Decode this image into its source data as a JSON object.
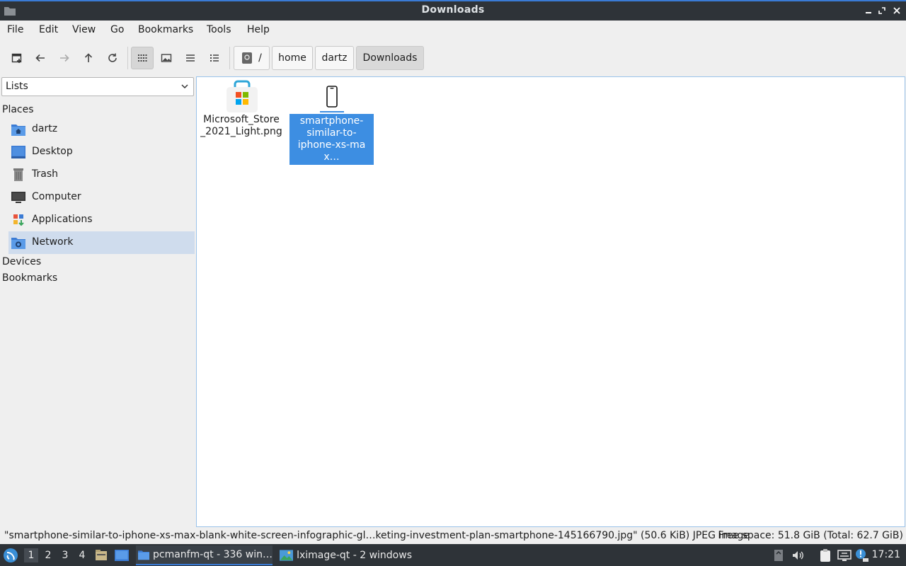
{
  "window": {
    "title": "Downloads"
  },
  "menu": [
    "File",
    "Edit",
    "View",
    "Go",
    "Bookmarks",
    "Tools",
    "Help"
  ],
  "breadcrumb": {
    "root": "/",
    "parts": [
      "home",
      "dartz",
      "Downloads"
    ]
  },
  "sidebar": {
    "combo_value": "Lists",
    "places_header": "Places",
    "places": [
      {
        "label": "dartz",
        "icon": "home-folder-icon"
      },
      {
        "label": "Desktop",
        "icon": "desktop-icon"
      },
      {
        "label": "Trash",
        "icon": "trash-icon"
      },
      {
        "label": "Computer",
        "icon": "computer-icon"
      },
      {
        "label": "Applications",
        "icon": "applications-icon"
      },
      {
        "label": "Network",
        "icon": "network-icon",
        "selected": true
      }
    ],
    "devices_header": "Devices",
    "bookmarks_header": "Bookmarks"
  },
  "files": [
    {
      "name": "Microsoft_Store_2021_Light.png",
      "line1": "Microsoft_Store",
      "line2": "_2021_Light.png",
      "icon": "microsoft-store-icon"
    },
    {
      "name": "smartphone-similar-to-iphone-xs-max…",
      "line1": "smartphone-",
      "line2": "similar-to-",
      "line3": "iphone-xs-max…",
      "icon": "smartphone-image-icon",
      "selected": true
    }
  ],
  "status": {
    "left": "\"smartphone-similar-to-iphone-xs-max-blank-white-screen-infographic-gl…keting-investment-plan-smartphone-145166790.jpg\" (50.6 KiB) JPEG image",
    "right": "Free space: 51.8 GiB (Total: 62.7 GiB)"
  },
  "taskbar": {
    "workspaces": [
      "1",
      "2",
      "3",
      "4"
    ],
    "tasks": [
      {
        "label": "pcmanfm-qt - 336 win…",
        "active": true
      },
      {
        "label": "lximage-qt - 2 windows",
        "active": false
      }
    ],
    "clock": "17:21"
  },
  "colors": {
    "accent": "#3d8ee2",
    "titlebar": "#2e3338",
    "selected_place": "#cfdced"
  }
}
